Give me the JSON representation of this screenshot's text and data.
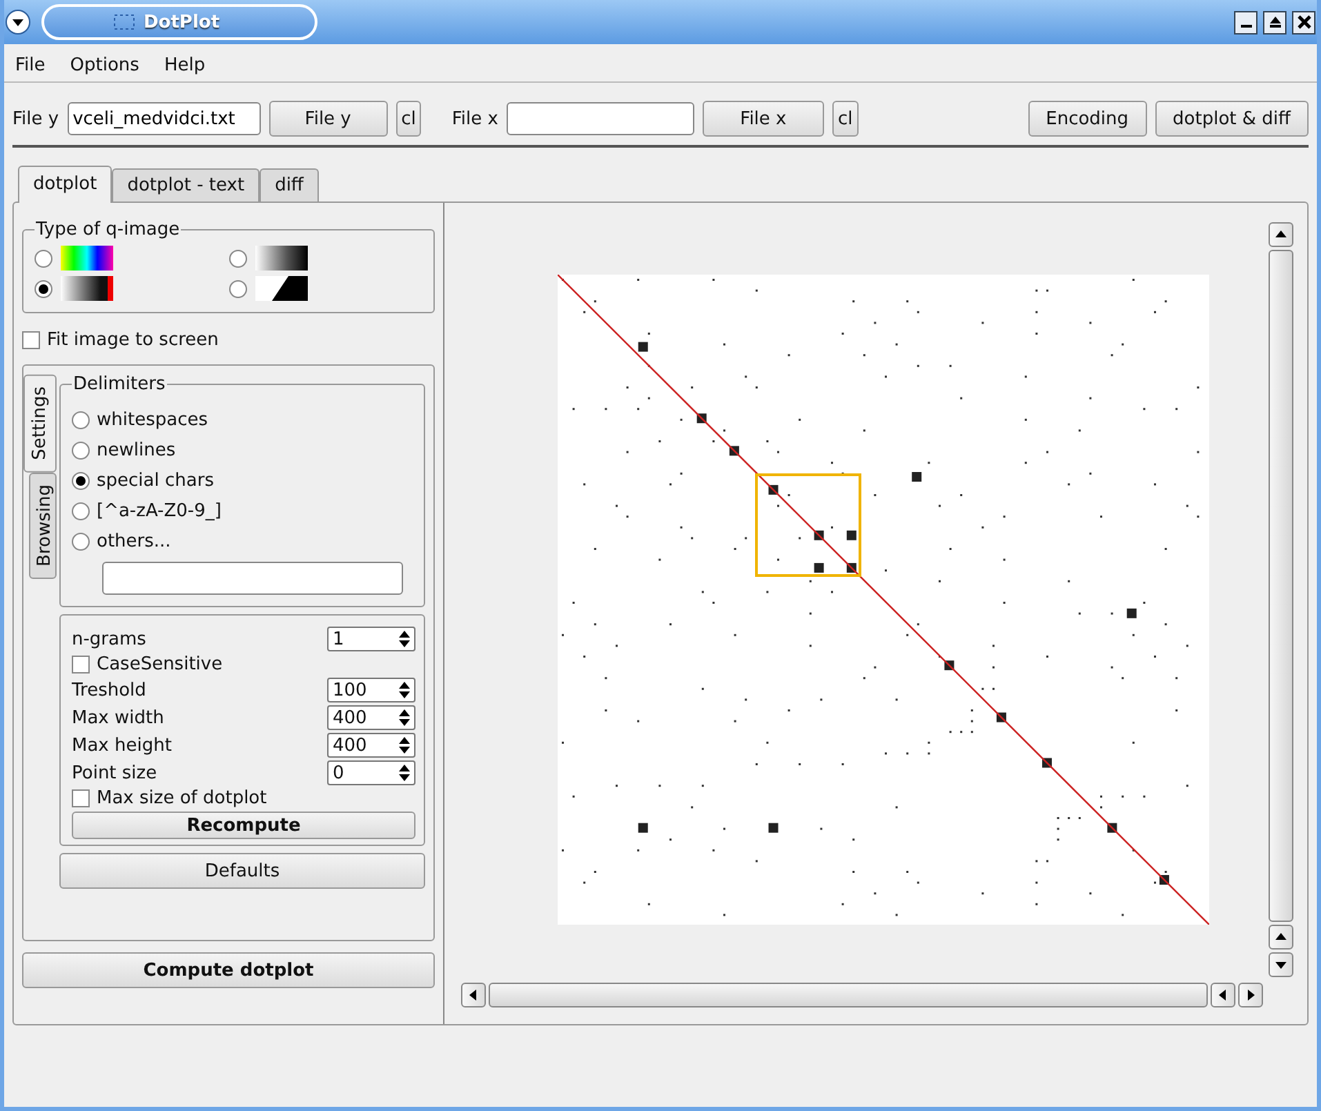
{
  "window": {
    "title": "DotPlot"
  },
  "menu": [
    "File",
    "Options",
    "Help"
  ],
  "toolbar": {
    "file_y": {
      "label": "File y",
      "value": "vceli_medvidci.txt",
      "button": "File y",
      "clear": "cl"
    },
    "file_x": {
      "label": "File x",
      "button": "File x",
      "clear": "cl"
    },
    "buttons": [
      "Encoding",
      "dotplot & diff"
    ]
  },
  "tabs": [
    {
      "label": "dotplot",
      "selected": true
    },
    {
      "label": "dotplot - text",
      "selected": false
    },
    {
      "label": "diff",
      "selected": false
    }
  ],
  "q_image": {
    "title": "Type of q-image",
    "options": [
      {
        "kind": "rainbow",
        "selected": false
      },
      {
        "kind": "gradient",
        "selected": false
      },
      {
        "kind": "gray_red",
        "selected": true
      },
      {
        "kind": "step",
        "selected": false
      }
    ]
  },
  "fit_to_screen": {
    "label": "Fit image to screen",
    "checked": false
  },
  "side_tabs": [
    {
      "label": "Settings",
      "selected": true
    },
    {
      "label": "Browsing",
      "selected": false
    }
  ],
  "delimiters": {
    "title": "Delimiters",
    "options": [
      {
        "label": "whitespaces",
        "selected": false
      },
      {
        "label": "newlines",
        "selected": false
      },
      {
        "label": "special chars",
        "selected": true
      },
      {
        "label": "[^a-zA-Z0-9_]",
        "selected": false
      },
      {
        "label": "others...",
        "selected": false
      }
    ]
  },
  "params": [
    {
      "kind": "spin",
      "label": "n-grams",
      "value": "1"
    },
    {
      "kind": "check",
      "label": "CaseSensitive",
      "checked": false
    },
    {
      "kind": "spin",
      "label": "Treshold",
      "value": "100"
    },
    {
      "kind": "spin",
      "label": "Max width",
      "value": "400"
    },
    {
      "kind": "spin",
      "label": "Max height",
      "value": "400"
    },
    {
      "kind": "spin",
      "label": "Point size",
      "value": "0"
    },
    {
      "kind": "check",
      "label": "Max size of dotplot",
      "checked": false
    }
  ],
  "recompute": "Recompute",
  "defaults": "Defaults",
  "compute": "Compute dotplot"
}
